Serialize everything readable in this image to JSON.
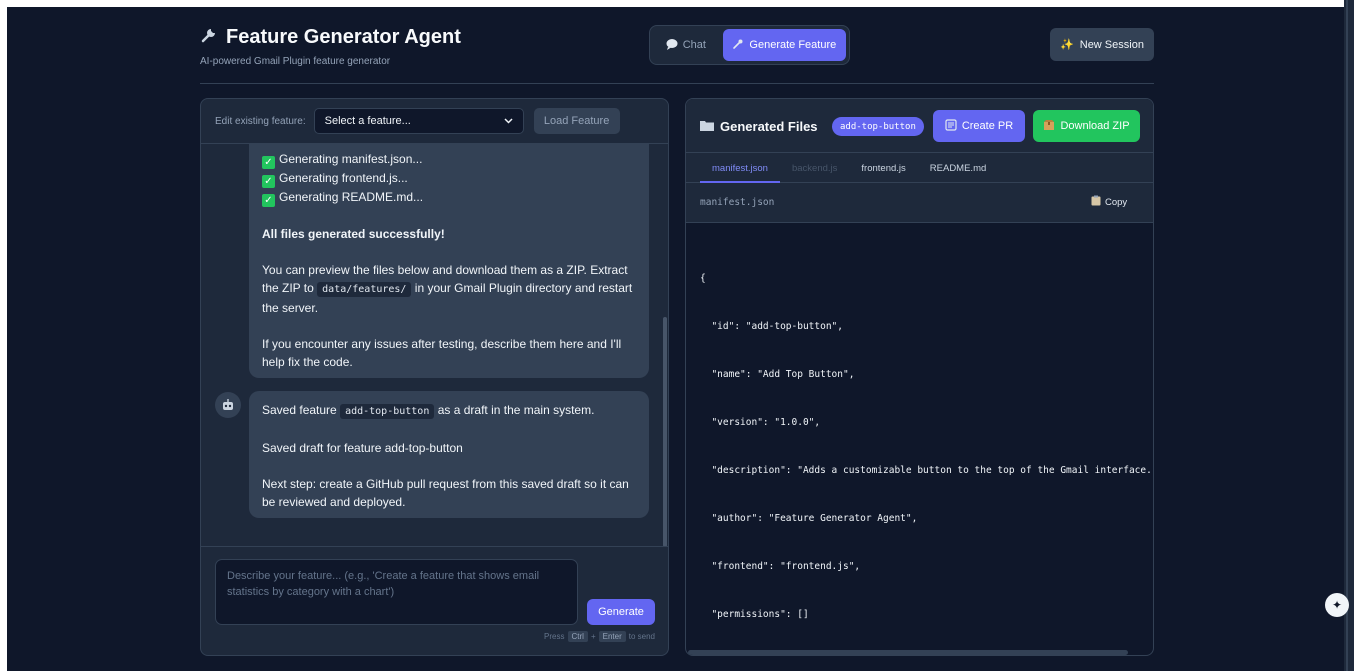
{
  "header": {
    "icon": "wrench-icon",
    "title": "Feature Generator Agent",
    "subtitle": "AI-powered Gmail Plugin feature generator"
  },
  "mode_switch": {
    "chat_label": "Chat",
    "chat_icon": "speech-bubble-icon",
    "generate_label": "Generate Feature",
    "generate_icon": "wrench-icon",
    "active": "Generate Feature"
  },
  "new_session": {
    "label": "New Session",
    "icon": "sparkles-icon"
  },
  "edit_bar": {
    "label": "Edit existing feature:",
    "select_value": "Select a feature...",
    "load_label": "Load Feature"
  },
  "messages": {
    "first": {
      "lines": [
        "Generating manifest.json...",
        "Generating frontend.js...",
        "Generating README.md..."
      ],
      "success": "All files generated successfully!",
      "preview_before": "You can preview the files below and download them as a ZIP. Extract the ZIP to",
      "preview_code": "data/features/",
      "preview_after": "in your Gmail Plugin directory and restart the server.",
      "issues": "If you encounter any issues after testing, describe them here and I'll help fix the code."
    },
    "second": {
      "saved_before": "Saved feature",
      "saved_code": "add-top-button",
      "saved_after": "as a draft in the main system.",
      "draft": "Saved draft for feature add-top-button",
      "next_step": "Next step: create a GitHub pull request from this saved draft so it can be reviewed and deployed."
    }
  },
  "input": {
    "placeholder": "Describe your feature... (e.g., 'Create a feature that shows email statistics by category with a chart')",
    "generate_label": "Generate",
    "hint_press": "Press",
    "hint_ctrl": "Ctrl",
    "hint_plus": "+",
    "hint_enter": "Enter",
    "hint_send": "to send"
  },
  "files": {
    "title": "Generated Files",
    "title_icon": "folder-icon",
    "feature_badge": "add-top-button",
    "create_pr_label": "Create PR",
    "download_zip_label": "Download ZIP",
    "tabs": [
      "manifest.json",
      "backend.js",
      "frontend.js",
      "README.md"
    ],
    "active_tab": "manifest.json",
    "current_file": "manifest.json",
    "copy_label": "Copy",
    "code_lines": [
      "{",
      "  \"id\": \"add-top-button\",",
      "  \"name\": \"Add Top Button\",",
      "  \"version\": \"1.0.0\",",
      "  \"description\": \"Adds a customizable button to the top of the Gmail interface.",
      "  \"author\": \"Feature Generator Agent\",",
      "  \"frontend\": \"frontend.js\",",
      "  \"permissions\": []",
      "}"
    ]
  },
  "colors": {
    "accent": "#6366f1",
    "success": "#22c55e",
    "background": "#0f172a",
    "panel": "#1e293b"
  }
}
